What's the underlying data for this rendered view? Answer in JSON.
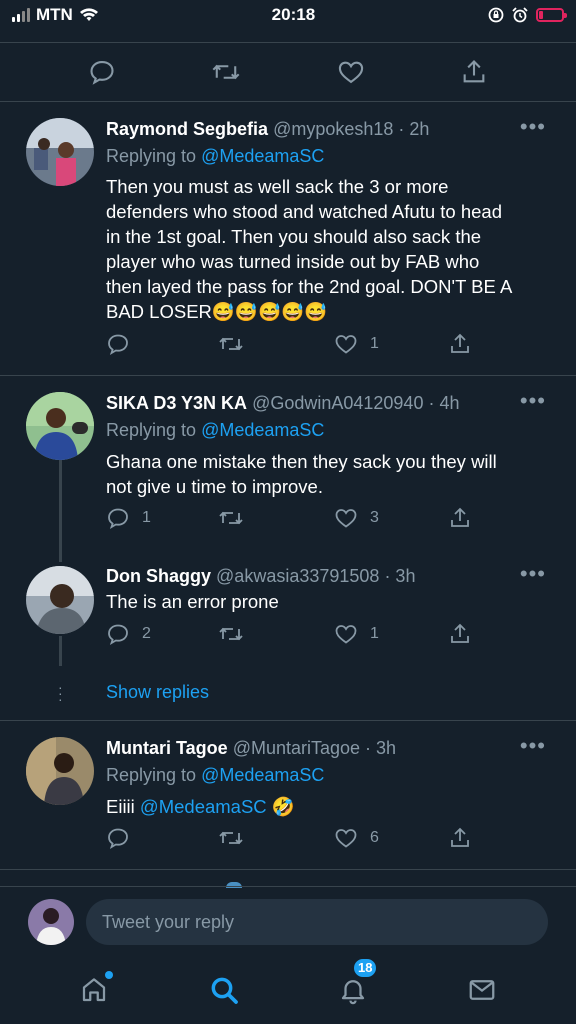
{
  "status_bar": {
    "carrier": "MTN",
    "time": "20:18"
  },
  "tweets": [
    {
      "name": "Raymond Segbefia",
      "handle": "@mypokesh18",
      "time": "· 2h",
      "replying_label": "Replying to",
      "replying_to": "@MedeamaSC",
      "body_lines": [
        "Then you must as well sack the 3 or more",
        "defenders who stood and watched Afutu to head",
        "in the 1st goal.  Then you should also sack the",
        "player who was turned inside out by FAB who",
        "then layed the pass for the 2nd goal. DON'T BE A",
        "BAD LOSER😅😅😅😅😅"
      ],
      "replies": "",
      "retweets": "",
      "likes": "1"
    },
    {
      "name": "SIKA D3 Y3N KA",
      "handle": "@GodwinA04120940",
      "time": "· 4h",
      "replying_label": "Replying to",
      "replying_to": "@MedeamaSC",
      "body_lines": [
        "Ghana one mistake then they sack you they will",
        "not give u time to improve."
      ],
      "replies": "1",
      "retweets": "",
      "likes": "3"
    },
    {
      "name": "Don Shaggy",
      "handle": "@akwasia33791508",
      "time": "· 3h",
      "body_lines": [
        "The is an error prone"
      ],
      "replies": "2",
      "retweets": "",
      "likes": "1"
    },
    {
      "name": "Muntari Tagoe",
      "handle": "@MuntariTagoe",
      "time": "· 3h",
      "replying_label": "Replying to",
      "replying_to": "@MedeamaSC",
      "body_prefix": "Eiiii ",
      "body_mention": "@MedeamaSC",
      "body_suffix": " 🤣",
      "replies": "",
      "retweets": "",
      "likes": "6"
    }
  ],
  "show_replies": "Show replies",
  "reply_bar": {
    "placeholder": "Tweet your reply"
  },
  "tab_bar": {
    "notifications_badge": "18"
  },
  "colors": {
    "background": "#15202b",
    "accent": "#1da1f2",
    "muted": "#8899a6",
    "border": "#38444d"
  },
  "icons": [
    "reply-icon",
    "retweet-icon",
    "like-icon",
    "share-icon",
    "more-icon",
    "home-icon",
    "search-icon",
    "notifications-icon",
    "messages-icon"
  ]
}
